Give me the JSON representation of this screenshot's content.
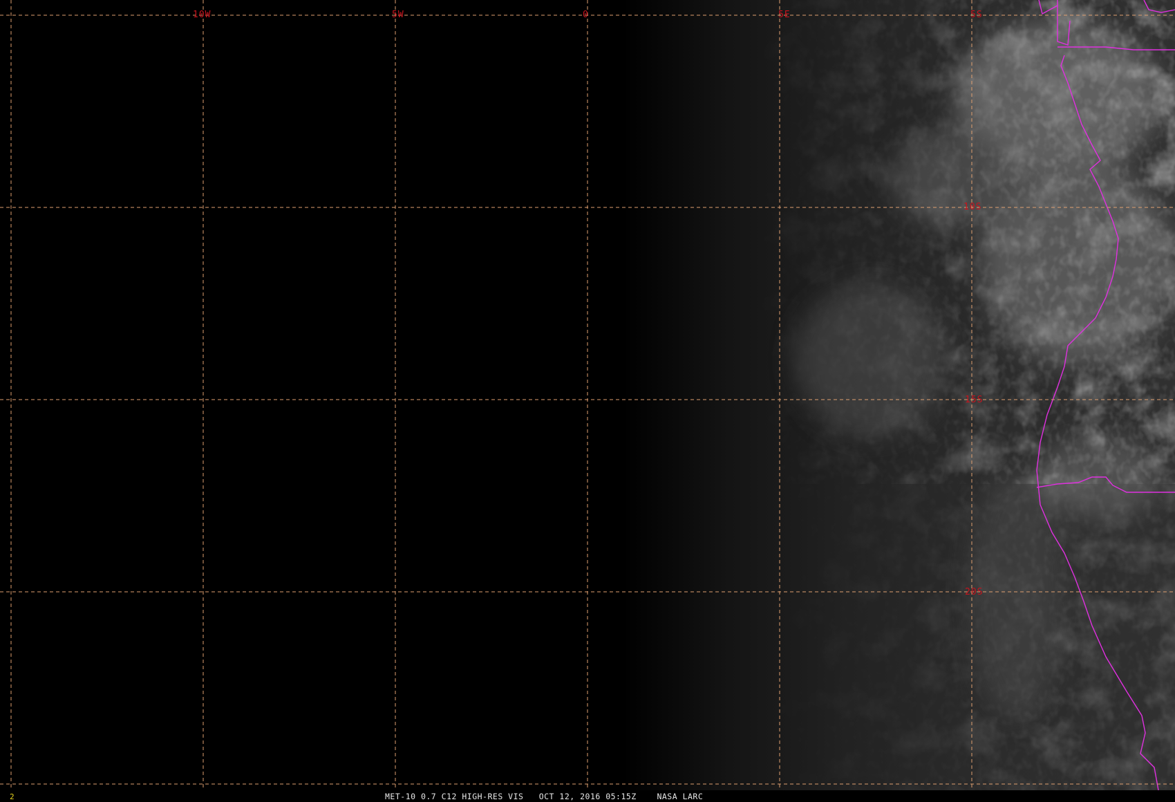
{
  "image": {
    "grid_color": "#e0a070",
    "label_color": "#c8141e",
    "border_color": "#e030e0",
    "frame_number_color": "#e6d21e",
    "caption_color": "#e8e8e8"
  },
  "grid": {
    "longitude_labels": [
      "10W",
      "5W",
      "0",
      "5E",
      "5S"
    ],
    "latitude_labels": [
      "10S",
      "15S",
      "20S"
    ]
  },
  "status": {
    "frame_number": "2",
    "caption": "MET-10 0.7 C12 HIGH-RES VIS   OCT 12, 2016 05:15Z    NASA LARC"
  }
}
